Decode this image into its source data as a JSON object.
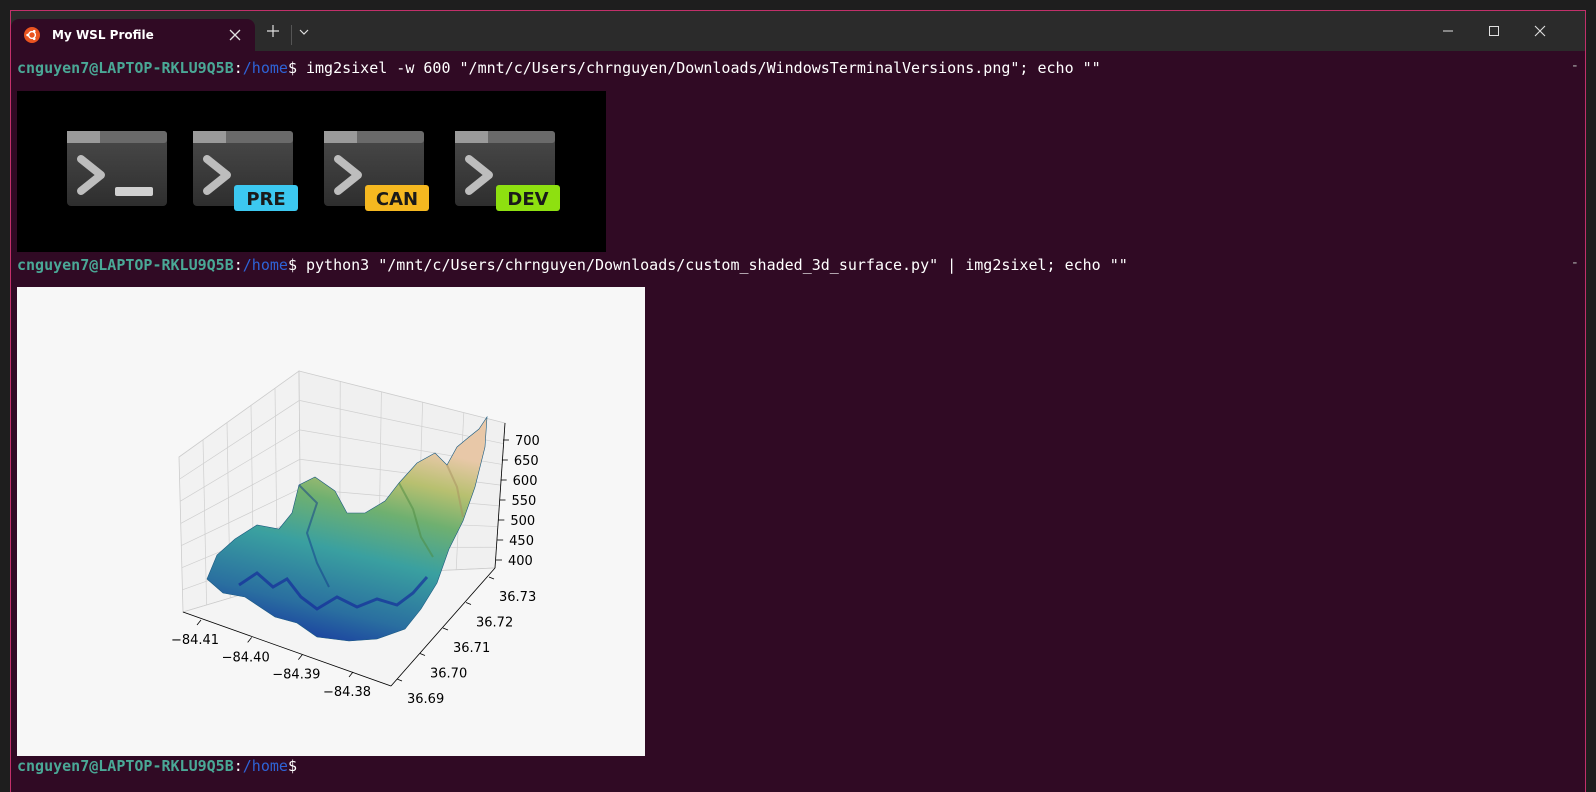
{
  "window": {
    "tab_title": "My WSL Profile",
    "tab_icon": "ubuntu-icon",
    "controls": [
      "new-tab-icon",
      "chevron-down-icon",
      "minimize-icon",
      "maximize-icon",
      "close-icon"
    ],
    "accent": "#c2306a",
    "background": "#300a24"
  },
  "prompt": {
    "user_host": "cnguyen7@LAPTOP-RKLU9Q5B",
    "colon": ":",
    "path": "/home",
    "dollar": "$",
    "user_color": "#4aa896",
    "path_color": "#2e63d6"
  },
  "commands": [
    {
      "text": " img2sixel -w 600 \"/mnt/c/Users/chrnguyen/Downloads/WindowsTerminalVersions.png\"; echo \"\""
    },
    {
      "text": " python3 \"/mnt/c/Users/chrnguyen/Downloads/custom_shaded_3d_surface.py\" | img2sixel; echo \"\""
    },
    {
      "text": ""
    }
  ],
  "scroll_mark": "-",
  "terminal_versions_image": {
    "badges": [
      {
        "label": "",
        "color": "#d0d0d0"
      },
      {
        "label": "PRE",
        "color": "#3cc8f0"
      },
      {
        "label": "CAN",
        "color": "#f5b820"
      },
      {
        "label": "DEV",
        "color": "#8ee010"
      }
    ]
  },
  "chart_data": {
    "type": "surface3d",
    "colormap": "gist_earth-like (blue to teal to green to tan)",
    "x_ticks": [
      "−84.41",
      "−84.40",
      "−84.39",
      "−84.38"
    ],
    "y_ticks": [
      "36.69",
      "36.70",
      "36.71",
      "36.72",
      "36.73"
    ],
    "z_ticks": [
      "400",
      "450",
      "500",
      "550",
      "600",
      "650",
      "700"
    ],
    "xlim": [
      -84.415,
      -84.375
    ],
    "ylim": [
      36.69,
      36.735
    ],
    "zlim": [
      380,
      720
    ]
  }
}
